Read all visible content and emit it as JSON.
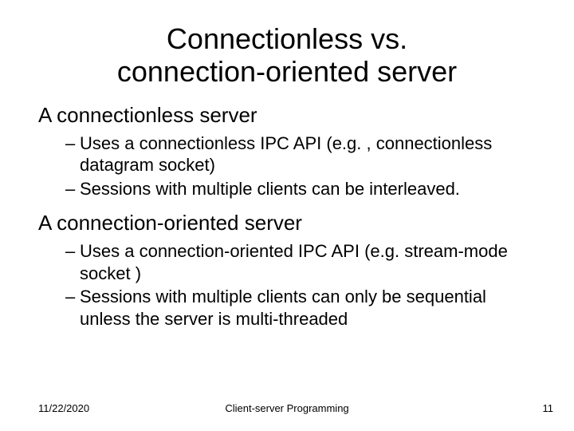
{
  "title_line1": "Connectionless vs.",
  "title_line2": "connection-oriented server",
  "section1": {
    "heading": "A connectionless server",
    "bullets": [
      "Uses a connectionless IPC API (e.g. , connectionless  datagram socket)",
      "Sessions with multiple clients can be interleaved."
    ]
  },
  "section2": {
    "heading": "A connection-oriented server",
    "bullets": [
      "Uses a connection-oriented IPC API (e.g. stream-mode socket )",
      "Sessions with multiple clients can only be sequential unless the server is multi-threaded"
    ]
  },
  "footer": {
    "date": "11/22/2020",
    "center": "Client-server Programming",
    "page": "11"
  }
}
